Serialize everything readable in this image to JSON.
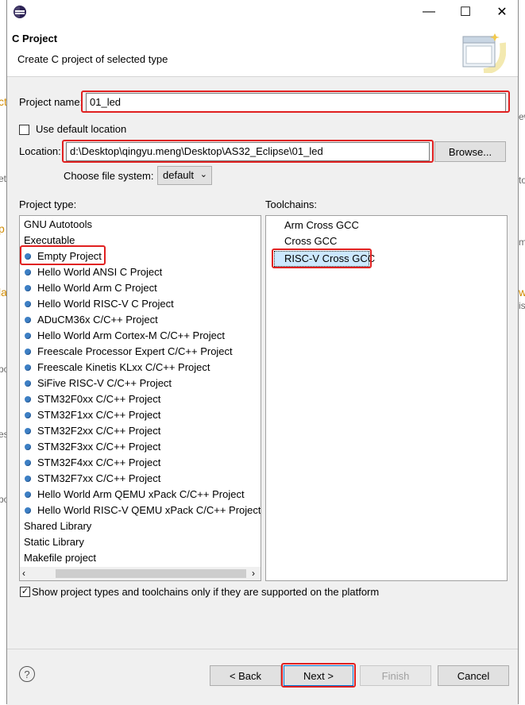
{
  "window": {
    "title_icon": "eclipse-icon",
    "minimize": "—",
    "maximize": "☐",
    "close": "✕"
  },
  "header": {
    "title": "C Project",
    "subtitle": "Create C project of selected type"
  },
  "form": {
    "project_name_label": "Project name:",
    "project_name_value": "01_led",
    "use_default_location_label": "Use default location",
    "use_default_location_checked": false,
    "location_label": "Location:",
    "location_value": "d:\\Desktop\\qingyu.meng\\Desktop\\AS32_Eclipse\\01_led",
    "browse_label": "Browse...",
    "file_system_label": "Choose file system:",
    "file_system_value": "default"
  },
  "project_type": {
    "label": "Project type:",
    "items": [
      {
        "label": "GNU Autotools",
        "icon": false
      },
      {
        "label": "Executable",
        "icon": false
      },
      {
        "label": "Empty Project",
        "icon": true
      },
      {
        "label": "Hello World ANSI C Project",
        "icon": true
      },
      {
        "label": "Hello World Arm C Project",
        "icon": true
      },
      {
        "label": "Hello World RISC-V C Project",
        "icon": true
      },
      {
        "label": "ADuCM36x C/C++ Project",
        "icon": true
      },
      {
        "label": "Hello World Arm Cortex-M C/C++ Project",
        "icon": true
      },
      {
        "label": "Freescale Processor Expert C/C++ Project",
        "icon": true
      },
      {
        "label": "Freescale Kinetis KLxx C/C++ Project",
        "icon": true
      },
      {
        "label": "SiFive RISC-V C/C++ Project",
        "icon": true
      },
      {
        "label": "STM32F0xx C/C++ Project",
        "icon": true
      },
      {
        "label": "STM32F1xx C/C++ Project",
        "icon": true
      },
      {
        "label": "STM32F2xx C/C++ Project",
        "icon": true
      },
      {
        "label": "STM32F3xx C/C++ Project",
        "icon": true
      },
      {
        "label": "STM32F4xx C/C++ Project",
        "icon": true
      },
      {
        "label": "STM32F7xx C/C++ Project",
        "icon": true
      },
      {
        "label": "Hello World Arm QEMU xPack C/C++ Project",
        "icon": true
      },
      {
        "label": "Hello World RISC-V QEMU xPack C/C++ Project",
        "icon": true
      },
      {
        "label": "Shared Library",
        "icon": false
      },
      {
        "label": "Static Library",
        "icon": false
      },
      {
        "label": "Makefile project",
        "icon": false
      }
    ]
  },
  "toolchains": {
    "label": "Toolchains:",
    "items": [
      {
        "label": "Arm Cross GCC"
      },
      {
        "label": "Cross GCC"
      },
      {
        "label": "RISC-V Cross GCC"
      }
    ]
  },
  "filter": {
    "label": "Show project types and toolchains only if they are supported on the platform",
    "checked": true
  },
  "buttons": {
    "help_icon": "?",
    "back": "< Back",
    "next": "Next >",
    "finish": "Finish",
    "cancel": "Cancel"
  },
  "background_fragments": {
    "left": [
      "ct",
      "et",
      "p",
      "la",
      "po",
      "es",
      "po"
    ],
    "right": [
      "ew",
      "to",
      "m",
      "w",
      "is"
    ]
  },
  "colors": {
    "highlight": "#e02020",
    "selection": "#cce8ff",
    "bullet": "#3d7fc4"
  }
}
